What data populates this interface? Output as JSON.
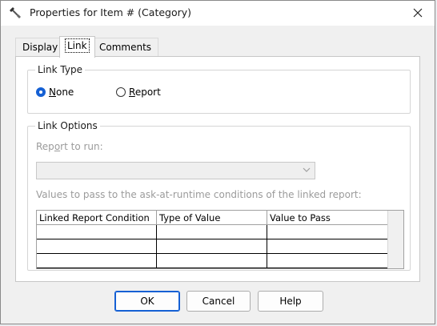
{
  "window": {
    "title": "Properties for Item # (Category)"
  },
  "icons": {
    "app": "wrench-hammer-icon",
    "close": "close-icon",
    "chevron": "chevron-down-icon"
  },
  "tabs": [
    {
      "label": "Display",
      "active": false
    },
    {
      "label": "Link",
      "active": true
    },
    {
      "label": "Comments",
      "active": false
    }
  ],
  "link_type": {
    "legend": "Link Type",
    "options": [
      {
        "label_accel": "N",
        "label_rest": "one",
        "selected": true
      },
      {
        "label_accel": "R",
        "label_rest": "eport",
        "selected": false
      }
    ]
  },
  "link_options": {
    "legend": "Link Options",
    "report_label_pre": "Rep",
    "report_label_accel": "o",
    "report_label_post": "rt to run:",
    "report_value": "",
    "values_label": "Values to pass to the ask-at-runtime conditions of the linked report:",
    "columns": [
      "Linked Report Condition",
      "Type of Value",
      "Value to Pass"
    ],
    "rows": [
      [
        "",
        "",
        ""
      ],
      [
        "",
        "",
        ""
      ],
      [
        "",
        "",
        ""
      ]
    ]
  },
  "buttons": {
    "ok": "OK",
    "cancel": "Cancel",
    "help": "Help"
  },
  "colors": {
    "accent": "#1560d4",
    "dialog_bg": "#f0f0f0",
    "disabled_text": "#9b9b9b"
  }
}
